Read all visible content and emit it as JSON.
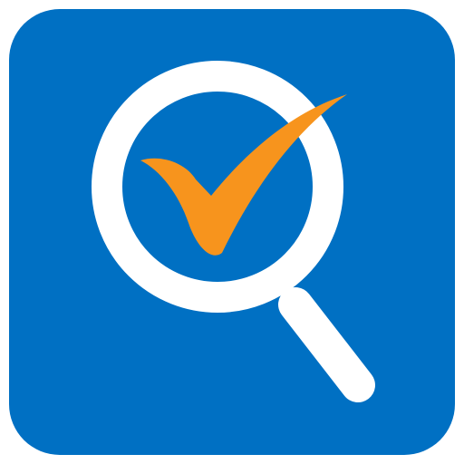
{
  "app_icon": {
    "icon_name": "search-check-icon",
    "colors": {
      "background": "#0070c3",
      "lens": "#ffffff",
      "handle": "#ffffff",
      "check": "#f7941d",
      "page": "#ffffff"
    }
  }
}
